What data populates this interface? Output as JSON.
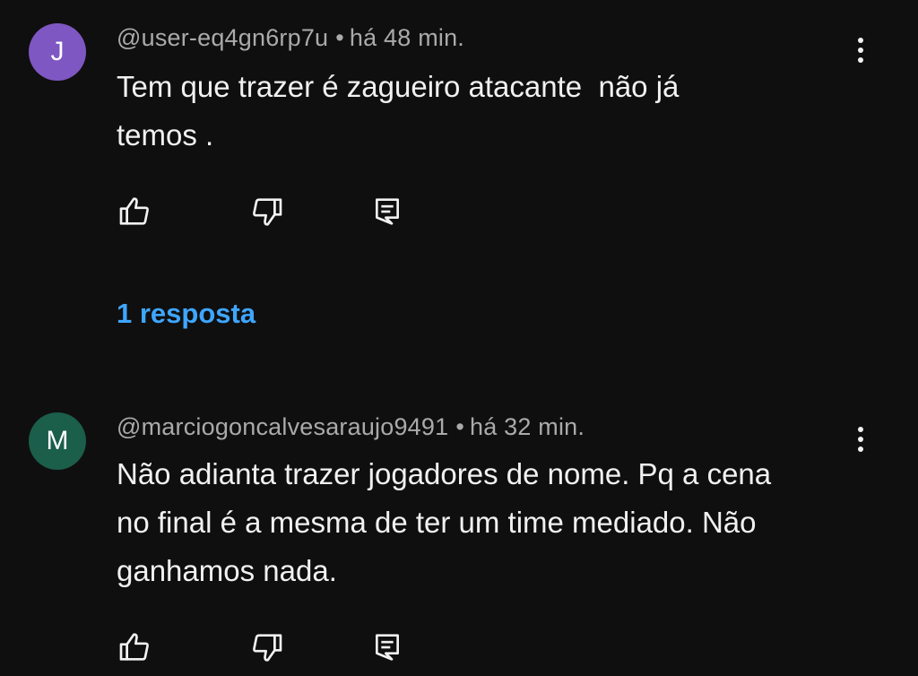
{
  "comments": [
    {
      "avatar_letter": "J",
      "avatar_color": "#7e57c2",
      "author": "@user-eq4gn6rp7u",
      "separator": "•",
      "time": "há 48 min.",
      "text": "Tem que trazer é zagueiro atacante  não já\ntemos .",
      "replies_label": "1 resposta"
    },
    {
      "avatar_letter": "M",
      "avatar_color": "#1b5e4a",
      "author": "@marciogoncalvesaraujo9491",
      "separator": "•",
      "time": "há 32 min.",
      "text": "Não adianta trazer jogadores de nome. Pq a cena\nno final é a mesma de ter um time mediado. Não\nganhamos nada."
    }
  ],
  "icons": {
    "like": "thumbs-up-icon",
    "dislike": "thumbs-down-icon",
    "reply": "comment-reply-icon",
    "menu": "more-vertical-icon"
  },
  "colors": {
    "background": "#0f0f0f",
    "text": "#f1f1f1",
    "meta": "#aaaaaa",
    "link": "#3ea6ff"
  }
}
